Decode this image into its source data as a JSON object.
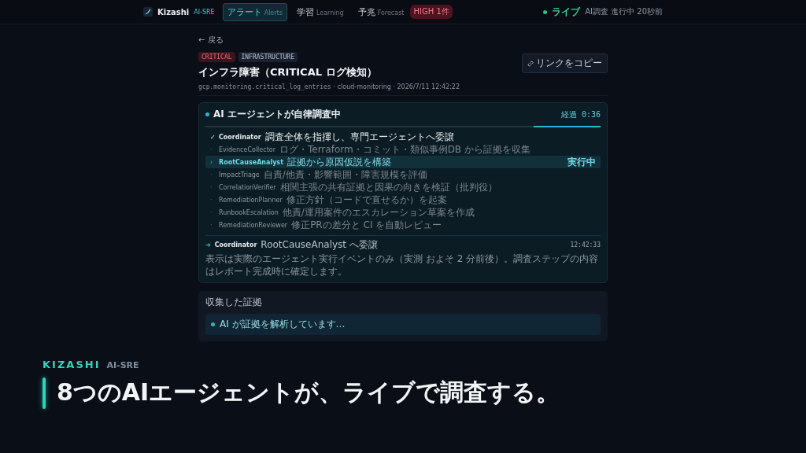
{
  "nav": {
    "brand": "Kizashi",
    "brand_tag": "AI-SRE",
    "tabs": [
      {
        "label": "アラート",
        "sub": "Alerts",
        "selected": true
      },
      {
        "label": "学習",
        "sub": "Learning",
        "selected": false
      },
      {
        "label": "予兆",
        "sub": "Forecast",
        "badge": "HIGH 1件",
        "selected": false
      }
    ],
    "live": {
      "label": "ライブ",
      "detail": "AI調査 進行中 20秒前"
    }
  },
  "back": "← 戻る",
  "tags": [
    {
      "text": "CRITICAL",
      "kind": "severity"
    },
    {
      "text": "INFRASTRUCTURE",
      "kind": "category"
    }
  ],
  "copy_button": "リンクをコピー",
  "title": "インフラ障害（CRITICAL ログ検知）",
  "meta": {
    "source": "gcp.monitoring.critical_log_entries",
    "rest": "· cloud-monitoring · 2026/7/11 12:42:22"
  },
  "investigation": {
    "title": "AI エージェントが自律調査中",
    "elapsed": "経過 0:36",
    "progress": {
      "level": 0.17
    },
    "agents": [
      {
        "kind": "done",
        "mark": "✓",
        "name": "Coordinator",
        "desc": "調査全体を指揮し、専門エージェントへ委譲"
      },
      {
        "kind": "pending",
        "mark": "·",
        "name": "EvidenceCollector",
        "desc": "ログ・Terraform・コミット・類似事例DB から証拠を収集"
      },
      {
        "kind": "running",
        "mark": "›",
        "name": "RootCauseAnalyst",
        "desc": "証拠から原因仮説を構築",
        "status": "実行中"
      },
      {
        "kind": "pending",
        "mark": "·",
        "name": "ImpactTriage",
        "desc": "自責/他責・影響範囲・障害規模を評価"
      },
      {
        "kind": "pending",
        "mark": "·",
        "name": "CorrelationVerifier",
        "desc": "相関主張の共有証拠と因果の向きを検証（批判役）"
      },
      {
        "kind": "pending",
        "mark": "·",
        "name": "RemediationPlanner",
        "desc": "修正方針（コードで直せるか）を起案"
      },
      {
        "kind": "pending",
        "mark": "·",
        "name": "RunbookEscalation",
        "desc": "他責/運用案件のエスカレーション草案を作成"
      },
      {
        "kind": "pending",
        "mark": "·",
        "name": "RemediationReviewer",
        "desc": "修正PRの差分と CI を自動レビュー"
      }
    ],
    "event": {
      "mark": "➔",
      "actor": "Coordinator",
      "text": "RootCauseAnalyst へ委譲",
      "time": "12:42:33"
    },
    "note": "表示は実際のエージェント実行イベントのみ（実測 およそ 2 分前後）。調査ステップの内容はレポート完成時に確定します。"
  },
  "evidence": {
    "title": "収集した証拠",
    "status": "AI が証拠を解析しています…"
  },
  "caption": {
    "brand": "KIZASHI",
    "tag": "AI-SRE",
    "headline": "8つのAIエージェントが、ライブで調査する。"
  }
}
